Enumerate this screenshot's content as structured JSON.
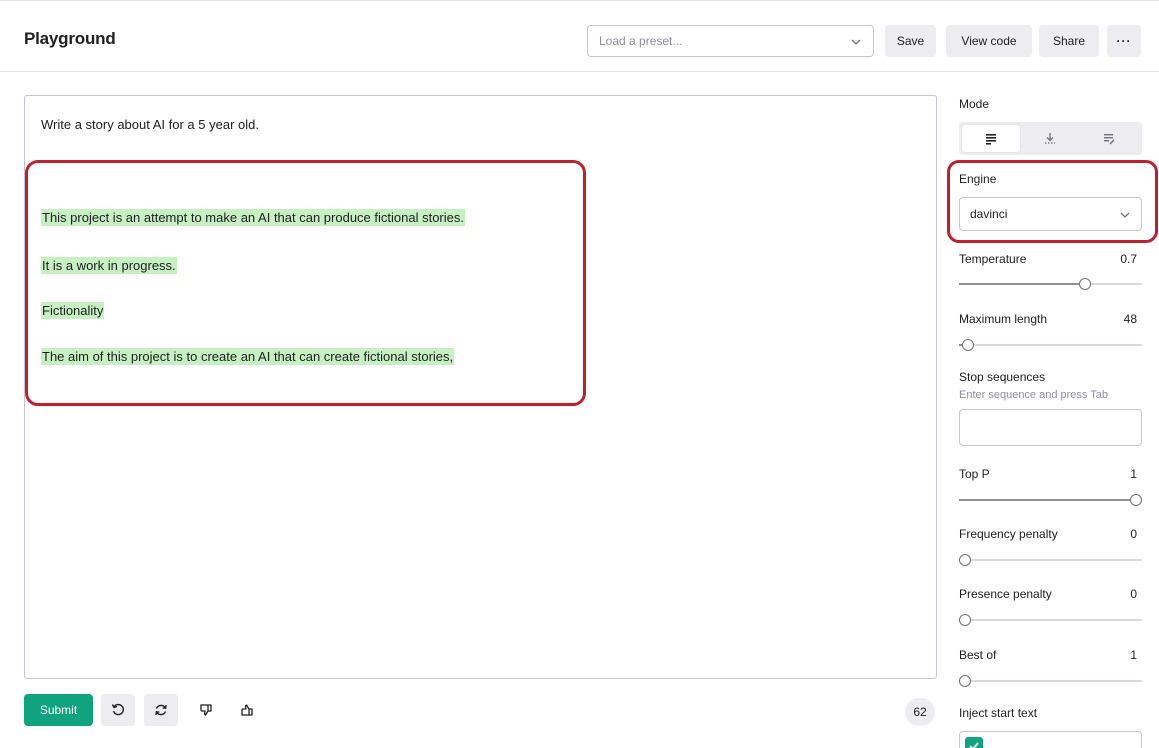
{
  "header": {
    "title": "Playground",
    "preset_placeholder": "Load a preset...",
    "save_label": "Save",
    "view_code_label": "View code",
    "share_label": "Share",
    "more_label": "···"
  },
  "editor": {
    "prompt": "Write a story about AI for a 5 year old.",
    "completion": [
      "This project is an attempt to make an AI that can produce fictional stories.",
      "It is a work in progress.",
      "Fictionality",
      "The aim of this project is to create an AI that can create fictional stories,"
    ],
    "highlight_color": "#c6f0c2",
    "annotation_color": "#c0202b"
  },
  "footer": {
    "submit_label": "Submit",
    "token_count": "62",
    "icons": [
      "undo-icon",
      "regenerate-icon",
      "thumbs-down-icon",
      "thumbs-up-icon"
    ]
  },
  "sidebar": {
    "mode_label": "Mode",
    "mode_icons": [
      "complete-mode-icon",
      "insert-mode-icon",
      "edit-mode-icon"
    ],
    "mode_active": 0,
    "engine_label": "Engine",
    "engine_value": "davinci",
    "temperature": {
      "label": "Temperature",
      "value": "0.7",
      "level": 0.7
    },
    "max_length": {
      "label": "Maximum length",
      "value": "48",
      "level": 0.02
    },
    "stop_sequences": {
      "label": "Stop sequences",
      "hint": "Enter sequence and press Tab"
    },
    "top_p": {
      "label": "Top P",
      "value": "1",
      "level": 1.0
    },
    "frequency_penalty": {
      "label": "Frequency penalty",
      "value": "0",
      "level": 0
    },
    "presence_penalty": {
      "label": "Presence penalty",
      "value": "0",
      "level": 0
    },
    "best_of": {
      "label": "Best of",
      "value": "1",
      "level": 0
    },
    "inject_start_text": {
      "label": "Inject start text",
      "checked": true
    }
  },
  "colors": {
    "accent": "#10a37f",
    "button_bg": "#ececf1",
    "border": "#c5c5d2"
  }
}
